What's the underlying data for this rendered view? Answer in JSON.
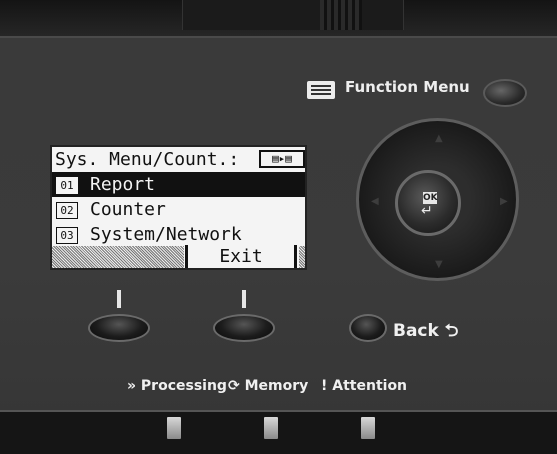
{
  "function_menu": {
    "label": "Function Menu",
    "icon": "menu-list-icon"
  },
  "lcd": {
    "title": "Sys. Menu/Count.:",
    "title_icon": "▤▸▤",
    "items": [
      {
        "num": "01",
        "label": "Report",
        "selected": true
      },
      {
        "num": "02",
        "label": "Counter",
        "selected": false
      },
      {
        "num": "03",
        "label": "System/Network",
        "selected": false
      }
    ],
    "softkey_right": "Exit"
  },
  "dpad": {
    "ok_label": "OK",
    "enter_glyph": "↵"
  },
  "back": {
    "label": "Back",
    "glyph": "⮌"
  },
  "status": [
    {
      "glyph": "»",
      "label": "Processing"
    },
    {
      "glyph": "⟳",
      "label": "Memory"
    },
    {
      "glyph": "!",
      "label": "Attention"
    }
  ],
  "colors": {
    "panel": "#3b3b3b",
    "lcd_bg": "#f4f4f4",
    "lcd_ink": "#111111",
    "label": "#f0f0f0"
  }
}
